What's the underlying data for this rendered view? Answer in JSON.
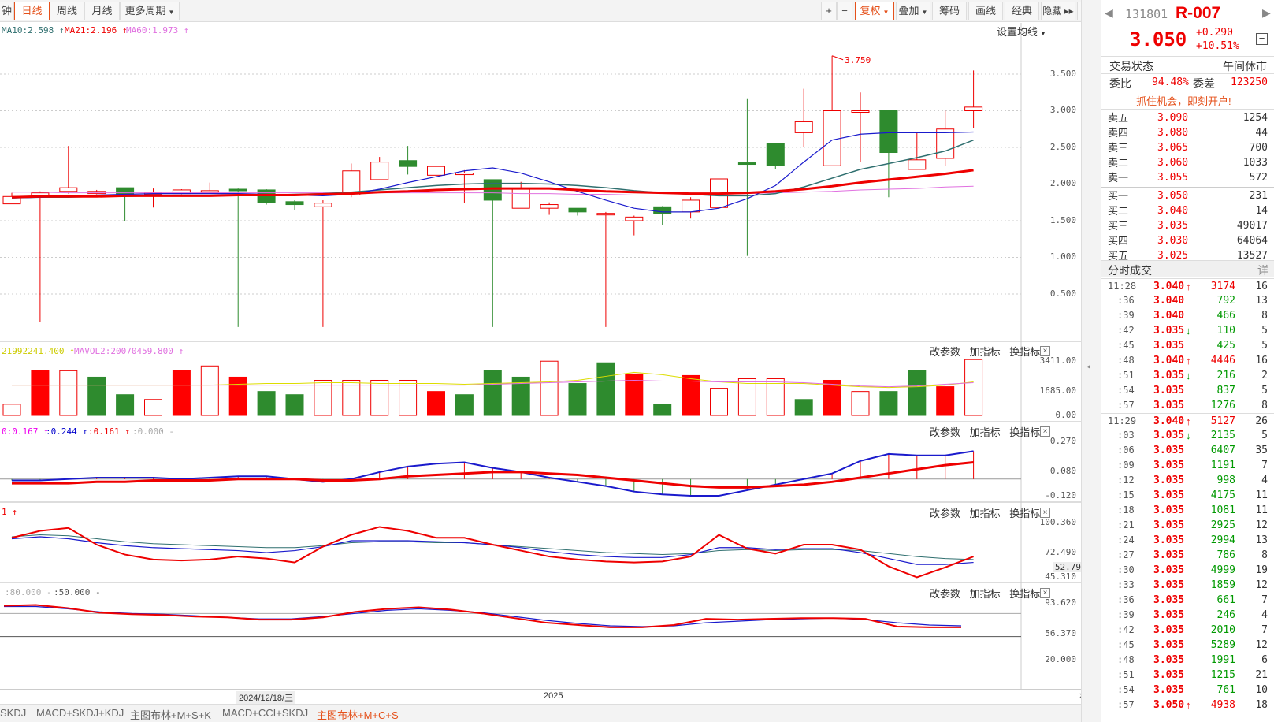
{
  "toolbar": {
    "left_cut": "钟",
    "tabs": [
      {
        "label": "日线",
        "active": true
      },
      {
        "label": "周线"
      },
      {
        "label": "月线"
      },
      {
        "label": "更多周期",
        "dropdown": true
      }
    ],
    "right": [
      {
        "label": "+"
      },
      {
        "label": "−"
      },
      {
        "label": "复权",
        "dropdown": true,
        "active": true
      },
      {
        "label": "叠加",
        "dropdown": true
      },
      {
        "label": "筹码"
      },
      {
        "label": "画线"
      },
      {
        "label": "经典"
      },
      {
        "label": "隐藏 ▸▸"
      }
    ],
    "fullscreen_icon": "fullscreen-icon"
  },
  "main": {
    "ma_labels": [
      {
        "text": "MA10:2.598 ↑",
        "color": "#2f6f6f"
      },
      {
        "text": "MA21:2.196 ↑",
        "color": "#e00"
      },
      {
        "text": "MA60:1.973 ↑",
        "color": "#e070e0"
      }
    ],
    "settings_label": "设置均线",
    "max_marker": "3.750",
    "y_ticks": [
      "3.500",
      "3.000",
      "2.500",
      "2.000",
      "1.500",
      "1.000",
      "0.500"
    ]
  },
  "vol": {
    "labels": [
      {
        "text": "21992241.400 ↑",
        "color": "#cc0"
      },
      {
        "text": "MAVOL2:20070459.800 ↑",
        "color": "#e070e0"
      }
    ],
    "y_ticks": [
      "3411.00",
      "1685.00",
      "0.00"
    ]
  },
  "macd": {
    "labels": [
      {
        "text": "0:0.167 ↑",
        "color": "#e0e"
      },
      {
        "text": ":0.244 ↑",
        "color": "#00c"
      },
      {
        "text": ":0.161 ↑",
        "color": "#e00"
      },
      {
        "text": ":0.000 -",
        "color": "#aaa"
      }
    ],
    "y_ticks": [
      "0.270",
      "0.080",
      "-0.120"
    ]
  },
  "ind3": {
    "labels": [
      {
        "text": "1 ↑",
        "color": "#e00"
      }
    ],
    "y_ticks": [
      "100.360",
      "72.490",
      "45.310"
    ],
    "current": "52.79"
  },
  "ind4": {
    "labels": [
      {
        "text": ":80.000 -",
        "color": "#aaa"
      },
      {
        "text": ":50.000 -",
        "color": "#555"
      }
    ],
    "y_ticks": [
      "93.620",
      "56.370",
      "20.000"
    ]
  },
  "panel_tools": {
    "change": "改参数",
    "add": "加指标",
    "swap": "换指标",
    "close": "×"
  },
  "xaxis": {
    "date_label": "2024/12/18/三",
    "year_label": "2025",
    "more": "»"
  },
  "bottom_tabs": [
    {
      "label": "SKDJ"
    },
    {
      "label": "MACD+SKDJ+KDJ"
    },
    {
      "label": "主图布林+M+S+K"
    },
    {
      "label": "MACD+CCI+SKDJ"
    },
    {
      "label": "主图布林+M+C+S",
      "active": true
    }
  ],
  "quote": {
    "code": "131801",
    "name": "R-007",
    "price": "3.050",
    "change": "+0.290",
    "pct": "+10.51%",
    "status_label": "交易状态",
    "status_value": "午间休市",
    "wb_label": "委比",
    "wb_value": "94.48%",
    "wc_label": "委差",
    "wc_value": "123250",
    "promo": "抓住机会，即刻开户!",
    "asks": [
      {
        "label": "卖五",
        "price": "3.090",
        "vol": "1254"
      },
      {
        "label": "卖四",
        "price": "3.080",
        "vol": "44"
      },
      {
        "label": "卖三",
        "price": "3.065",
        "vol": "700"
      },
      {
        "label": "卖二",
        "price": "3.060",
        "vol": "1033"
      },
      {
        "label": "卖一",
        "price": "3.055",
        "vol": "572"
      }
    ],
    "bids": [
      {
        "label": "买一",
        "price": "3.050",
        "vol": "231"
      },
      {
        "label": "买二",
        "price": "3.040",
        "vol": "14"
      },
      {
        "label": "买三",
        "price": "3.035",
        "vol": "49017"
      },
      {
        "label": "买四",
        "price": "3.030",
        "vol": "64064"
      },
      {
        "label": "买五",
        "price": "3.025",
        "vol": "13527"
      }
    ],
    "ticks_title": "分时成交",
    "ticks_more": "详",
    "ticks": [
      {
        "t": "11:28",
        "p": "3.040",
        "a": "up",
        "v": "3174",
        "vc": "red",
        "n": "16"
      },
      {
        "t": ":36",
        "p": "3.040",
        "a": "",
        "v": "792",
        "vc": "green",
        "n": "13"
      },
      {
        "t": ":39",
        "p": "3.040",
        "a": "",
        "v": "466",
        "vc": "green",
        "n": "8"
      },
      {
        "t": ":42",
        "p": "3.035",
        "a": "down",
        "v": "110",
        "vc": "green",
        "n": "5"
      },
      {
        "t": ":45",
        "p": "3.035",
        "a": "",
        "v": "425",
        "vc": "green",
        "n": "5"
      },
      {
        "t": ":48",
        "p": "3.040",
        "a": "up",
        "v": "4446",
        "vc": "red",
        "n": "16"
      },
      {
        "t": ":51",
        "p": "3.035",
        "a": "down",
        "v": "216",
        "vc": "green",
        "n": "2"
      },
      {
        "t": ":54",
        "p": "3.035",
        "a": "",
        "v": "837",
        "vc": "green",
        "n": "5"
      },
      {
        "t": ":57",
        "p": "3.035",
        "a": "",
        "v": "1276",
        "vc": "green",
        "n": "8"
      },
      {
        "t": "11:29",
        "p": "3.040",
        "a": "up",
        "v": "5127",
        "vc": "red",
        "n": "26"
      },
      {
        "t": ":03",
        "p": "3.035",
        "a": "down",
        "v": "2135",
        "vc": "green",
        "n": "5"
      },
      {
        "t": ":06",
        "p": "3.035",
        "a": "",
        "v": "6407",
        "vc": "green",
        "n": "35"
      },
      {
        "t": ":09",
        "p": "3.035",
        "a": "",
        "v": "1191",
        "vc": "green",
        "n": "7"
      },
      {
        "t": ":12",
        "p": "3.035",
        "a": "",
        "v": "998",
        "vc": "green",
        "n": "4"
      },
      {
        "t": ":15",
        "p": "3.035",
        "a": "",
        "v": "4175",
        "vc": "green",
        "n": "11"
      },
      {
        "t": ":18",
        "p": "3.035",
        "a": "",
        "v": "1081",
        "vc": "green",
        "n": "11"
      },
      {
        "t": ":21",
        "p": "3.035",
        "a": "",
        "v": "2925",
        "vc": "green",
        "n": "12"
      },
      {
        "t": ":24",
        "p": "3.035",
        "a": "",
        "v": "2994",
        "vc": "green",
        "n": "13"
      },
      {
        "t": ":27",
        "p": "3.035",
        "a": "",
        "v": "786",
        "vc": "green",
        "n": "8"
      },
      {
        "t": ":30",
        "p": "3.035",
        "a": "",
        "v": "4999",
        "vc": "green",
        "n": "19"
      },
      {
        "t": ":33",
        "p": "3.035",
        "a": "",
        "v": "1859",
        "vc": "green",
        "n": "12"
      },
      {
        "t": ":36",
        "p": "3.035",
        "a": "",
        "v": "661",
        "vc": "green",
        "n": "7"
      },
      {
        "t": ":39",
        "p": "3.035",
        "a": "",
        "v": "246",
        "vc": "green",
        "n": "4"
      },
      {
        "t": ":42",
        "p": "3.035",
        "a": "",
        "v": "2010",
        "vc": "green",
        "n": "7"
      },
      {
        "t": ":45",
        "p": "3.035",
        "a": "",
        "v": "5289",
        "vc": "green",
        "n": "12"
      },
      {
        "t": ":48",
        "p": "3.035",
        "a": "",
        "v": "1991",
        "vc": "green",
        "n": "6"
      },
      {
        "t": ":51",
        "p": "3.035",
        "a": "",
        "v": "1215",
        "vc": "green",
        "n": "21"
      },
      {
        "t": ":54",
        "p": "3.035",
        "a": "",
        "v": "761",
        "vc": "green",
        "n": "10"
      },
      {
        "t": ":57",
        "p": "3.050",
        "a": "up",
        "v": "4938",
        "vc": "red",
        "n": "18"
      }
    ]
  },
  "chart_data": {
    "type": "candlestick",
    "y_range": [
      0.5,
      3.75
    ],
    "candles": [
      {
        "o": 1.73,
        "c": 1.83,
        "h": 1.88,
        "l": 1.73
      },
      {
        "o": 1.84,
        "c": 1.88,
        "h": 1.9,
        "l": 0.12
      },
      {
        "o": 1.9,
        "c": 1.95,
        "h": 2.52,
        "l": 1.87
      },
      {
        "o": 1.87,
        "c": 1.9,
        "h": 1.92,
        "l": 1.86
      },
      {
        "o": 1.95,
        "c": 1.85,
        "h": 1.95,
        "l": 1.5
      },
      {
        "o": 1.88,
        "c": 1.88,
        "h": 1.94,
        "l": 1.68
      },
      {
        "o": 1.87,
        "c": 1.92,
        "h": 1.93,
        "l": 1.86
      },
      {
        "o": 1.91,
        "c": 1.91,
        "h": 2.02,
        "l": 1.88
      },
      {
        "o": 1.93,
        "c": 1.91,
        "h": 1.94,
        "l": 0.05
      },
      {
        "o": 1.92,
        "c": 1.75,
        "h": 1.93,
        "l": 1.72
      },
      {
        "o": 1.76,
        "c": 1.72,
        "h": 1.78,
        "l": 1.65
      },
      {
        "o": 1.69,
        "c": 1.74,
        "h": 1.78,
        "l": 0.05
      },
      {
        "o": 1.85,
        "c": 2.18,
        "h": 2.28,
        "l": 1.82
      },
      {
        "o": 2.06,
        "c": 2.3,
        "h": 2.37,
        "l": 2.05
      },
      {
        "o": 2.32,
        "c": 2.24,
        "h": 2.52,
        "l": 2.13
      },
      {
        "o": 2.12,
        "c": 2.24,
        "h": 2.35,
        "l": 2.07
      },
      {
        "o": 2.15,
        "c": 2.15,
        "h": 2.19,
        "l": 1.74
      },
      {
        "o": 2.06,
        "c": 1.78,
        "h": 2.06,
        "l": 0.05
      },
      {
        "o": 1.67,
        "c": 1.93,
        "h": 2.03,
        "l": 1.67
      },
      {
        "o": 1.67,
        "c": 1.72,
        "h": 1.75,
        "l": 1.58
      },
      {
        "o": 1.67,
        "c": 1.62,
        "h": 1.67,
        "l": 1.57
      },
      {
        "o": 1.6,
        "c": 1.6,
        "h": 1.62,
        "l": 0.05
      },
      {
        "o": 1.5,
        "c": 1.55,
        "h": 1.57,
        "l": 1.3
      },
      {
        "o": 1.69,
        "c": 1.6,
        "h": 1.7,
        "l": 1.44
      },
      {
        "o": 1.62,
        "c": 1.78,
        "h": 1.82,
        "l": 1.53
      },
      {
        "o": 1.68,
        "c": 2.07,
        "h": 2.13,
        "l": 1.68
      },
      {
        "o": 2.29,
        "c": 2.28,
        "h": 3.17,
        "l": 1.02
      },
      {
        "o": 2.55,
        "c": 2.25,
        "h": 2.55,
        "l": 2.2
      },
      {
        "o": 2.7,
        "c": 2.85,
        "h": 3.3,
        "l": 2.5
      },
      {
        "o": 2.25,
        "c": 3.0,
        "h": 3.75,
        "l": 2.25
      },
      {
        "o": 3.0,
        "c": 3.0,
        "h": 3.25,
        "l": 2.3
      },
      {
        "o": 3.0,
        "c": 2.43,
        "h": 3.0,
        "l": 1.82
      },
      {
        "o": 2.2,
        "c": 2.33,
        "h": 2.7,
        "l": 2.2
      },
      {
        "o": 2.35,
        "c": 2.75,
        "h": 3.0,
        "l": 2.25
      },
      {
        "o": 3.0,
        "c": 3.05,
        "h": 3.55,
        "l": 2.76
      }
    ],
    "ma10": [
      1.81,
      1.82,
      1.83,
      1.85,
      1.86,
      1.87,
      1.87,
      1.87,
      1.87,
      1.86,
      1.85,
      1.84,
      1.86,
      1.93,
      2.02,
      2.1,
      2.18,
      2.22,
      2.15,
      2.03,
      1.9,
      1.78,
      1.67,
      1.62,
      1.62,
      1.67,
      1.8,
      1.98,
      2.3,
      2.6,
      2.68,
      2.7,
      2.7,
      2.7,
      2.71
    ],
    "ma21": [
      1.81,
      1.82,
      1.82,
      1.83,
      1.83,
      1.84,
      1.84,
      1.84,
      1.85,
      1.85,
      1.86,
      1.87,
      1.89,
      1.92,
      1.95,
      1.98,
      2.0,
      2.01,
      2.01,
      2.0,
      1.98,
      1.95,
      1.91,
      1.88,
      1.86,
      1.84,
      1.84,
      1.87,
      1.96,
      2.08,
      2.2,
      2.28,
      2.36,
      2.45,
      2.6
    ],
    "ma60": [
      1.81,
      1.81,
      1.81,
      1.82,
      1.82,
      1.82,
      1.83,
      1.83,
      1.84,
      1.84,
      1.85,
      1.86,
      1.87,
      1.88,
      1.9,
      1.92,
      1.95,
      1.96,
      1.97,
      1.96,
      1.93,
      1.89,
      1.86,
      1.85,
      1.85,
      1.85,
      1.86,
      1.87,
      1.9,
      1.95,
      2.01,
      2.05,
      2.09,
      2.14,
      2.19
    ],
    "ma_thick": [
      1.82,
      1.83,
      1.83,
      1.83,
      1.84,
      1.84,
      1.84,
      1.84,
      1.85,
      1.85,
      1.85,
      1.86,
      1.87,
      1.89,
      1.9,
      1.92,
      1.93,
      1.94,
      1.94,
      1.94,
      1.92,
      1.9,
      1.89,
      1.88,
      1.87,
      1.87,
      1.88,
      1.9,
      1.93,
      1.97,
      2.02,
      2.06,
      2.1,
      2.14,
      2.19
    ],
    "ma_pink": [
      1.89,
      1.89,
      1.88,
      1.88,
      1.88,
      1.88,
      1.88,
      1.88,
      1.88,
      1.88,
      1.88,
      1.88,
      1.88,
      1.88,
      1.88,
      1.88,
      1.88,
      1.88,
      1.87,
      1.87,
      1.86,
      1.86,
      1.85,
      1.85,
      1.85,
      1.86,
      1.87,
      1.88,
      1.89,
      1.9,
      1.92,
      1.93,
      1.94,
      1.96,
      1.97
    ],
    "volumes": [
      700,
      2800,
      2800,
      2400,
      1300,
      1000,
      2800,
      3100,
      2400,
      1500,
      1300,
      2200,
      2200,
      2200,
      2200,
      1500,
      1300,
      2800,
      2400,
      3400,
      2000,
      3300,
      2600,
      700,
      2500,
      1700,
      2300,
      2300,
      1000,
      2200,
      1500,
      1500,
      2800,
      1800,
      3500,
      1650
    ],
    "vol_filled": [
      false,
      true,
      false,
      true,
      true,
      false,
      true,
      false,
      true,
      true,
      true,
      false,
      false,
      false,
      false,
      true,
      true,
      true,
      true,
      false,
      true,
      true,
      true,
      true,
      true,
      false,
      false,
      false,
      true,
      true,
      false,
      true,
      true,
      true,
      false,
      false
    ],
    "vol_ma1": [
      1900,
      1900,
      1900,
      1900,
      1900,
      1900,
      1900,
      1900,
      1950,
      2000,
      2000,
      2050,
      2050,
      2000,
      2000,
      2000,
      1950,
      2000,
      2050,
      2100,
      2200,
      2450,
      2700,
      2550,
      2300,
      2100,
      2000,
      2000,
      2000,
      1900,
      1800,
      1750,
      1800,
      1900,
      2100,
      2200
    ],
    "vol_ma2": [
      1900,
      1900,
      1900,
      1900,
      1900,
      1900,
      1900,
      1900,
      1900,
      1900,
      1900,
      1900,
      1900,
      1900,
      1900,
      1900,
      1900,
      1950,
      2000,
      2050,
      2100,
      2150,
      2200,
      2150,
      2150,
      2100,
      2100,
      2100,
      2050,
      1950,
      1850,
      1800,
      1850,
      1950,
      2050,
      2100
    ],
    "macd_dif": [
      -0.01,
      -0.01,
      0.0,
      0.01,
      0.01,
      0.01,
      0.0,
      0.01,
      0.02,
      0.02,
      0.0,
      -0.02,
      0.0,
      0.05,
      0.09,
      0.11,
      0.12,
      0.08,
      0.05,
      0.01,
      -0.02,
      -0.05,
      -0.09,
      -0.11,
      -0.12,
      -0.12,
      -0.08,
      -0.04,
      0.0,
      0.04,
      0.13,
      0.18,
      0.17,
      0.17,
      0.2,
      0.24
    ],
    "macd_dea": [
      -0.03,
      -0.03,
      -0.03,
      -0.02,
      -0.02,
      -0.01,
      -0.01,
      -0.01,
      0.0,
      0.0,
      0.0,
      -0.01,
      -0.01,
      0.0,
      0.02,
      0.03,
      0.04,
      0.05,
      0.05,
      0.04,
      0.03,
      0.01,
      -0.01,
      -0.03,
      -0.05,
      -0.06,
      -0.06,
      -0.05,
      -0.04,
      -0.02,
      0.01,
      0.04,
      0.07,
      0.1,
      0.12,
      0.16
    ],
    "ind3_a": [
      85,
      92,
      95,
      78,
      68,
      63,
      62,
      63,
      66,
      64,
      60,
      76,
      88,
      96,
      92,
      85,
      85,
      78,
      72,
      66,
      63,
      61,
      60,
      61,
      66,
      88,
      74,
      69,
      78,
      78,
      73,
      56,
      45,
      55,
      66
    ],
    "ind3_b": [
      84,
      86,
      84,
      80,
      77,
      75,
      74,
      73,
      72,
      70,
      72,
      76,
      82,
      82,
      82,
      81,
      80,
      78,
      75,
      71,
      68,
      66,
      65,
      65,
      68,
      75,
      75,
      73,
      74,
      74,
      70,
      64,
      58,
      58,
      60
    ],
    "ind3_c": [
      86,
      88,
      87,
      84,
      81,
      79,
      78,
      77,
      76,
      75,
      75,
      77,
      80,
      81,
      81,
      80,
      80,
      78,
      76,
      74,
      72,
      70,
      69,
      68,
      69,
      72,
      73,
      72,
      73,
      73,
      72,
      69,
      66,
      64,
      63
    ],
    "ind4_a": [
      90,
      91,
      87,
      81,
      79,
      78,
      76,
      75,
      72,
      72,
      75,
      82,
      86,
      88,
      85,
      80,
      74,
      68,
      65,
      62,
      62,
      65,
      73,
      72,
      73,
      74,
      74,
      73,
      63,
      62,
      62
    ],
    "ind4_b": [
      89,
      89,
      86,
      82,
      80,
      79,
      77,
      75,
      73,
      73,
      76,
      80,
      84,
      86,
      84,
      81,
      76,
      71,
      67,
      64,
      63,
      64,
      68,
      70,
      72,
      73,
      74,
      72,
      68,
      65,
      64
    ]
  }
}
